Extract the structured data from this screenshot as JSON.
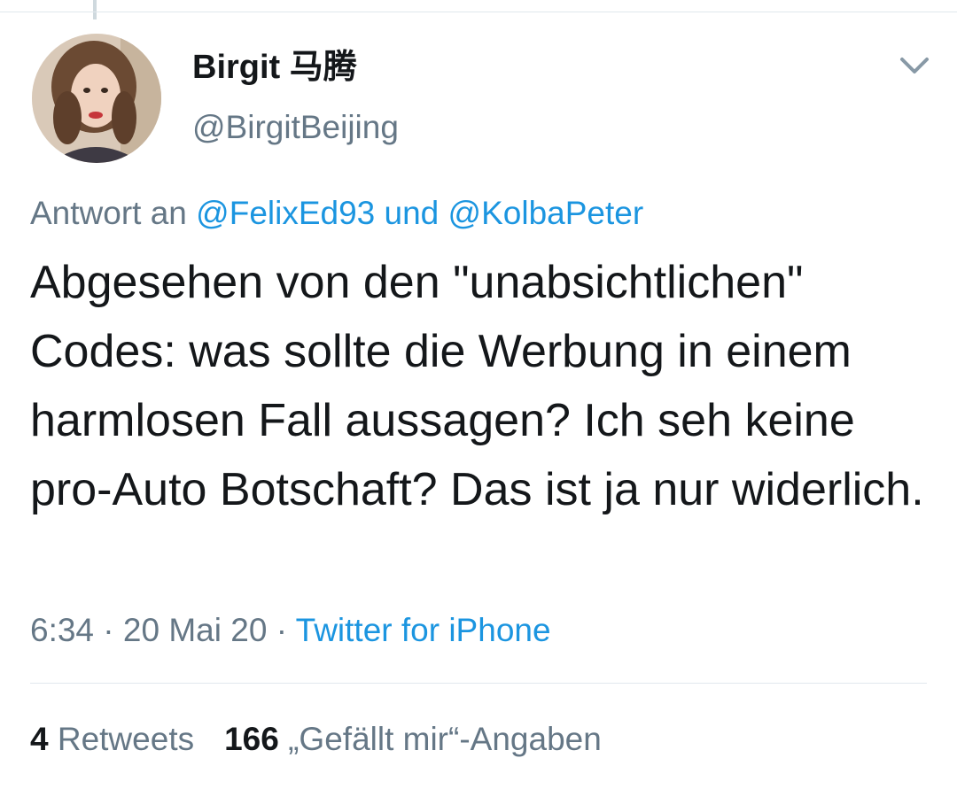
{
  "author": {
    "display_name": "Birgit 马腾",
    "handle": "@BirgitBeijing"
  },
  "reply": {
    "prefix": "Antwort an",
    "mention1": "@FelixEd93",
    "conjunction": "und",
    "mention2": "@KolbaPeter"
  },
  "tweet": {
    "text": "Abgesehen von den \"unabsichtlichen\" Codes: was sollte die Werbung in einem harmlosen Fall aussagen? Ich seh keine pro-Auto Botschaft? Das ist ja nur widerlich.",
    "time": "6:34",
    "date": "20 Mai 20",
    "separator": "·",
    "source": "Twitter for iPhone"
  },
  "stats": {
    "retweets_count": "4",
    "retweets_label": "Retweets",
    "likes_count": "166",
    "likes_label": "„Gefällt mir“-Angaben"
  },
  "icons": {
    "menu": "chevron-down-icon"
  },
  "colors": {
    "link": "#1b95e0",
    "secondary_text": "#657786",
    "primary_text": "#14171a",
    "divider": "#e1e8ed"
  }
}
